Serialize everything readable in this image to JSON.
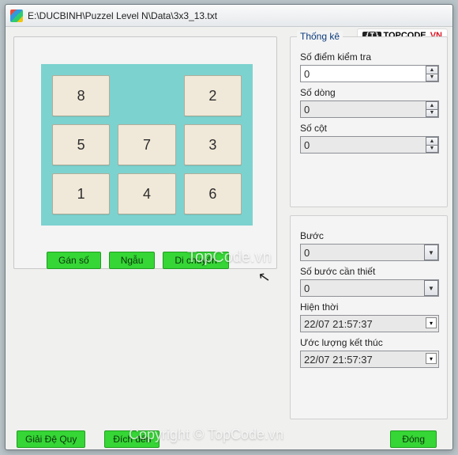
{
  "window": {
    "title": "E:\\DUCBINH\\Puzzel Level N\\Data\\3x3_13.txt"
  },
  "logo": {
    "code": "{T}",
    "name": "TOPCODE",
    "suffix": ".VN"
  },
  "watermark1": "TopCode.vn",
  "watermark2": "Copyright © TopCode.vn",
  "puzzle": {
    "tiles": [
      "8",
      "",
      "2",
      "5",
      "7",
      "3",
      "1",
      "4",
      "6"
    ]
  },
  "left_buttons": {
    "assign": "Gán số",
    "random": "Ngẫu",
    "move": "Di chuyển"
  },
  "stats_group": {
    "title": "Thống kê",
    "check_points_label": "Số điểm kiểm tra",
    "check_points_value": "0",
    "rows_label": "Số dòng",
    "rows_value": "0",
    "cols_label": "Số cột",
    "cols_value": "0"
  },
  "progress_group": {
    "title": "",
    "step_label": "Bước",
    "step_value": "0",
    "needed_label": "Số bước cần thiết",
    "needed_value": "0",
    "now_label": "Hiện thời",
    "now_value": "22/07 21:57:37",
    "eta_label": "Ước lượng kết thúc",
    "eta_value": "22/07 21:57:37"
  },
  "bottom": {
    "recursive": "Giải Đệ Quy",
    "dest": "Đích đến",
    "close": "Đóng"
  }
}
